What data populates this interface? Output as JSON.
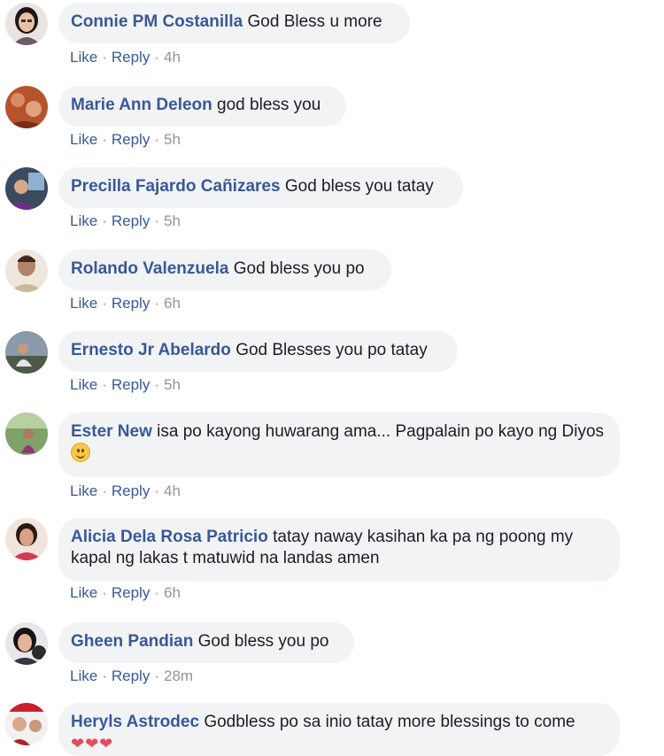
{
  "actions": {
    "like": "Like",
    "reply": "Reply",
    "separator": "·"
  },
  "comments": [
    {
      "author": "Connie PM Costanilla",
      "text": "God Bless u more",
      "time": "4h"
    },
    {
      "author": "Marie Ann Deleon",
      "text": "god bless you",
      "time": "5h"
    },
    {
      "author": "Precilla Fajardo Cañizares",
      "text": "God bless you tatay",
      "time": "5h"
    },
    {
      "author": "Rolando Valenzuela",
      "text": "God bless you po",
      "time": "6h"
    },
    {
      "author": "Ernesto Jr Abelardo",
      "text": "God Blesses you po tatay",
      "time": "5h"
    },
    {
      "author": "Ester New",
      "text": "isa po kayong huwarang ama... Pagpalain po kayo ng Diyos",
      "emoji": "smile-emoji",
      "time": "4h"
    },
    {
      "author": "Alicia Dela Rosa Patricio",
      "text": "tatay naway kasihan ka pa ng poong my kapal ng lakas t matuwid na landas amen",
      "time": "6h"
    },
    {
      "author": "Gheen Pandian",
      "text": "God bless you po",
      "time": "28m"
    },
    {
      "author": "Heryls Astrodec",
      "text": "Godbless po sa inio tatay more blessings to come",
      "trailing": "❤❤❤"
    }
  ],
  "colors": {
    "link": "#385898",
    "bubble": "#f2f3f5",
    "muted": "#90949c",
    "text": "#1c1e21"
  }
}
